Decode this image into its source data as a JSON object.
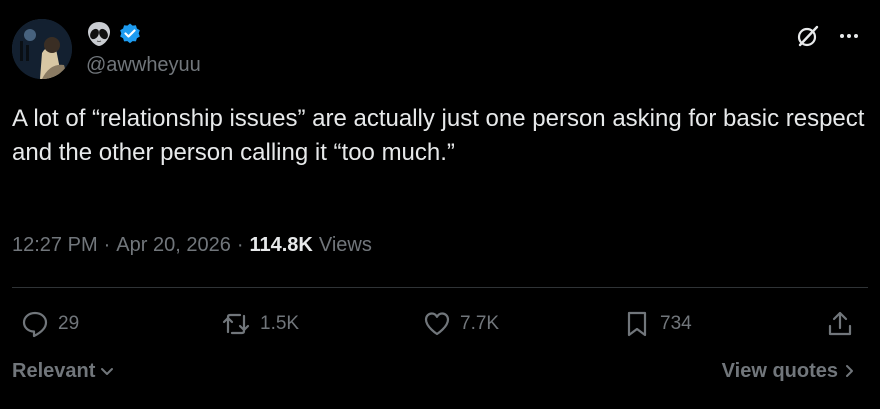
{
  "author": {
    "display_icon": "alien-emoji",
    "verified": true,
    "handle": "@awwheyuu"
  },
  "tweet": {
    "text": "A lot of “relationship issues” are actually just one person asking for basic respect\nand the other person calling it “too much.”",
    "time": "12:27 PM",
    "separator": "·",
    "date": "Apr 20, 2026",
    "views_count": "114.8K",
    "views_label": "Views"
  },
  "actions": {
    "replies": "29",
    "reposts": "1.5K",
    "likes": "7.7K",
    "bookmarks": "734"
  },
  "footer": {
    "sort_label": "Relevant",
    "quotes_label": "View quotes"
  },
  "colors": {
    "background": "#000000",
    "text": "#e7e9ea",
    "muted": "#71767b",
    "verified": "#1d9bf0",
    "divider": "#2f3336"
  }
}
